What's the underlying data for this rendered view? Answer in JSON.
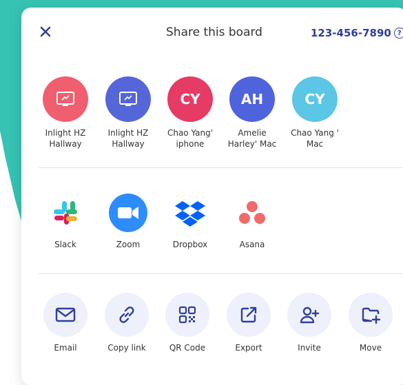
{
  "header": {
    "title": "Share this board",
    "phone": "123-456-7890",
    "help_glyph": "?"
  },
  "devices": [
    {
      "label_line1": "Inlight HZ",
      "label_line2": "Hallway",
      "type": "screen",
      "color": "#ef5f6f"
    },
    {
      "label_line1": "Inlight HZ",
      "label_line2": "Hallway",
      "type": "screen",
      "color": "#5566d8"
    },
    {
      "initials": "CY",
      "label_line1": "Chao Yang'",
      "label_line2": "iphone",
      "color": "#e63b64"
    },
    {
      "initials": "AH",
      "label_line1": "Amelie",
      "label_line2": "Harley' Mac",
      "color": "#4f63dc"
    },
    {
      "initials": "CY",
      "label_line1": "Chao Yang '",
      "label_line2": "Mac",
      "color": "#5bc6e6"
    }
  ],
  "apps": [
    {
      "label": "Slack",
      "icon": "slack-icon"
    },
    {
      "label": "Zoom",
      "icon": "zoom-icon"
    },
    {
      "label": "Dropbox",
      "icon": "dropbox-icon"
    },
    {
      "label": "Asana",
      "icon": "asana-icon"
    }
  ],
  "actions": [
    {
      "label": "Email",
      "icon": "mail-icon"
    },
    {
      "label": "Copy link",
      "icon": "link-icon"
    },
    {
      "label": "QR Code",
      "icon": "qr-code-icon"
    },
    {
      "label": "Export",
      "icon": "export-icon"
    },
    {
      "label": "Invite",
      "icon": "add-user-icon"
    },
    {
      "label": "Move",
      "icon": "folder-add-icon"
    }
  ]
}
